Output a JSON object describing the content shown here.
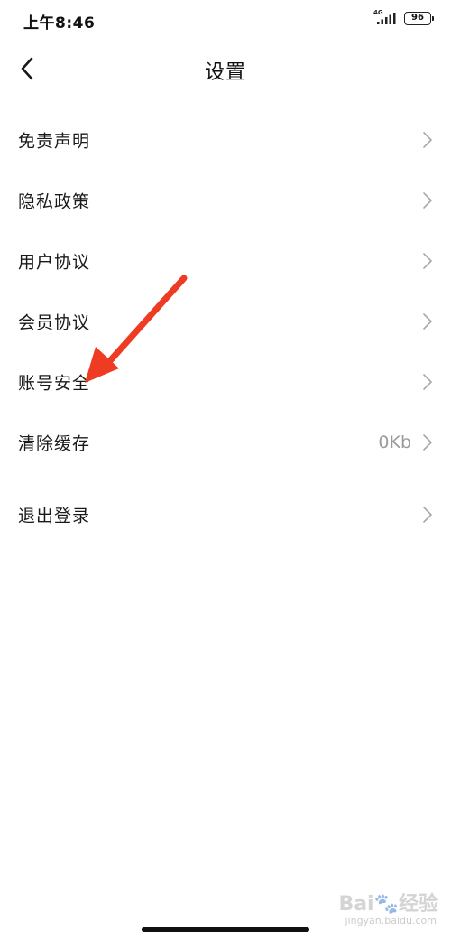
{
  "status_bar": {
    "time": "上午8:46",
    "network": "4G",
    "battery": "96",
    "signal_icon": "cellular-signal-icon",
    "battery_icon": "battery-icon"
  },
  "header": {
    "title": "设置",
    "back_icon": "chevron-left-icon"
  },
  "settings": {
    "items": [
      {
        "label": "免责声明",
        "value": ""
      },
      {
        "label": "隐私政策",
        "value": ""
      },
      {
        "label": "用户协议",
        "value": ""
      },
      {
        "label": "会员协议",
        "value": ""
      },
      {
        "label": "账号安全",
        "value": ""
      },
      {
        "label": "清除缓存",
        "value": "0Kb"
      }
    ],
    "logout": {
      "label": "退出登录"
    },
    "chevron_icon": "chevron-right-icon"
  },
  "watermark": {
    "logo": "Bai🐾经验",
    "sub": "jingyan.baidu.com"
  },
  "colors": {
    "background": "#ffffff",
    "text_primary": "#1a1a1a",
    "text_secondary": "#9a9a9a",
    "chevron": "#a8a8a8",
    "annotation_arrow": "#ef3b24"
  }
}
